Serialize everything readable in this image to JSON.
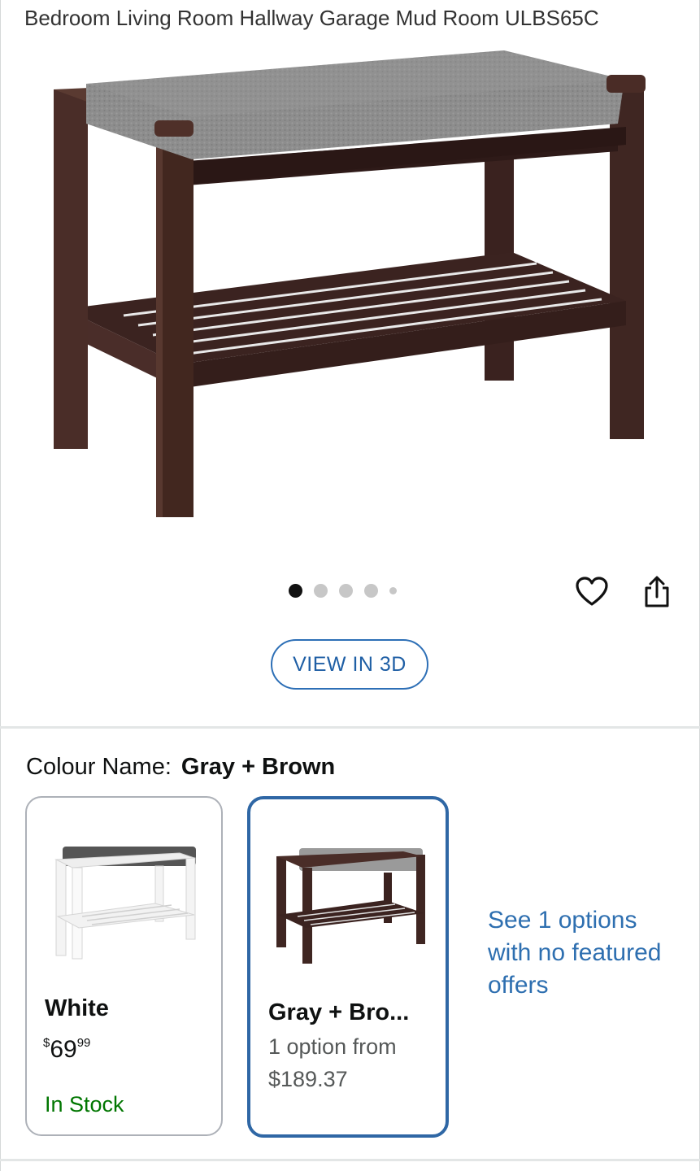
{
  "product": {
    "title_line": "Bedroom Living Room Hallway Garage Mud Room ULBS65C"
  },
  "gallery": {
    "image_count": 5,
    "active_index": 0,
    "wishlist_icon": "heart-icon",
    "share_icon": "share-icon",
    "view_3d_label": "VIEW IN 3D"
  },
  "variation": {
    "label": "Colour Name:",
    "selected_value": "Gray + Brown",
    "options": [
      {
        "name": "White",
        "price_symbol": "$",
        "price_whole": "69",
        "price_fraction": "99",
        "availability": "In Stock",
        "selected": false
      },
      {
        "name": "Gray + Bro...",
        "offer_line": "1 option from",
        "offer_price": "$189.37",
        "selected": true
      }
    ],
    "more_options_link": "See 1 options with no featured offers"
  },
  "colors": {
    "link_blue": "#2e6fb0",
    "selected_border": "#2f67a5",
    "in_stock_green": "#007600",
    "bench_wood": "#3f2622",
    "cushion_gray": "#8b8b8b"
  }
}
